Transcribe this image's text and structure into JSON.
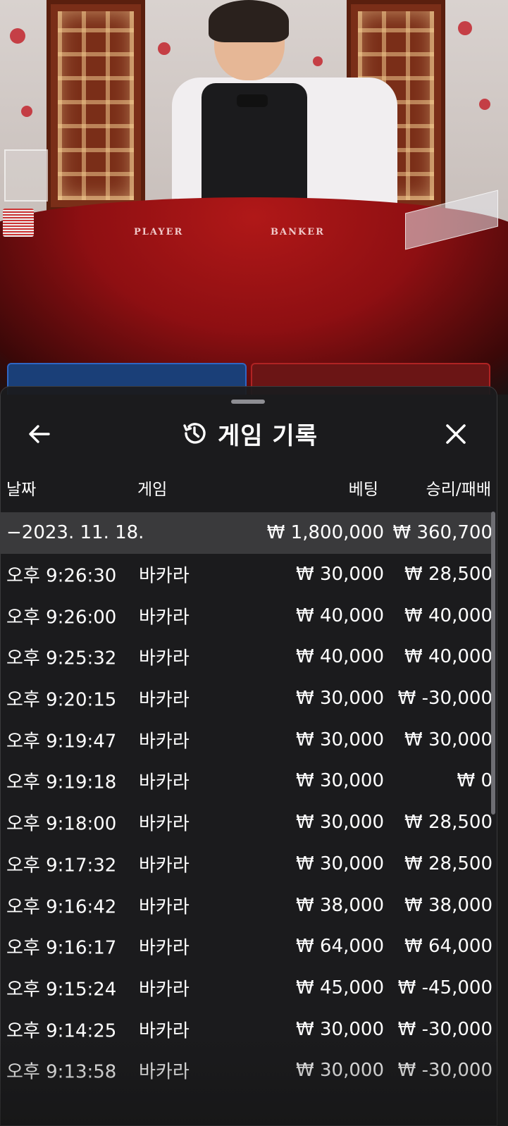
{
  "header": {
    "title": "게임 기록",
    "back_icon": "back-arrow-icon",
    "history_icon": "history-clock-icon",
    "close_icon": "close-icon"
  },
  "columns": {
    "date": "날짜",
    "game": "게임",
    "bet": "베팅",
    "result": "승리/패배"
  },
  "summary": {
    "date": "−2023. 11. 18.",
    "bet": "₩ 1,800,000",
    "result": "₩ 360,700"
  },
  "rows": [
    {
      "time": "오후 9:26:30",
      "game": "바카라",
      "bet": "₩ 30,000",
      "result": "₩ 28,500"
    },
    {
      "time": "오후 9:26:00",
      "game": "바카라",
      "bet": "₩ 40,000",
      "result": "₩ 40,000"
    },
    {
      "time": "오후 9:25:32",
      "game": "바카라",
      "bet": "₩ 40,000",
      "result": "₩ 40,000"
    },
    {
      "time": "오후 9:20:15",
      "game": "바카라",
      "bet": "₩ 30,000",
      "result": "₩ -30,000"
    },
    {
      "time": "오후 9:19:47",
      "game": "바카라",
      "bet": "₩ 30,000",
      "result": "₩ 30,000"
    },
    {
      "time": "오후 9:19:18",
      "game": "바카라",
      "bet": "₩ 30,000",
      "result": "₩ 0"
    },
    {
      "time": "오후 9:18:00",
      "game": "바카라",
      "bet": "₩ 30,000",
      "result": "₩ 28,500"
    },
    {
      "time": "오후 9:17:32",
      "game": "바카라",
      "bet": "₩ 30,000",
      "result": "₩ 28,500"
    },
    {
      "time": "오후 9:16:42",
      "game": "바카라",
      "bet": "₩ 38,000",
      "result": "₩ 38,000"
    },
    {
      "time": "오후 9:16:17",
      "game": "바카라",
      "bet": "₩ 64,000",
      "result": "₩ 64,000"
    },
    {
      "time": "오후 9:15:24",
      "game": "바카라",
      "bet": "₩ 45,000",
      "result": "₩ -45,000"
    },
    {
      "time": "오후 9:14:25",
      "game": "바카라",
      "bet": "₩ 30,000",
      "result": "₩ -30,000"
    },
    {
      "time": "오후 9:13:58",
      "game": "바카라",
      "bet": "₩ 30,000",
      "result": "₩ -30,000"
    }
  ],
  "table_labels": {
    "player": "PLAYER",
    "banker": "BANKER"
  },
  "colors": {
    "sheet_bg": "#1c1c1e",
    "summary_row_bg": "#3a3a3c",
    "felt_red": "#8e0f12"
  }
}
